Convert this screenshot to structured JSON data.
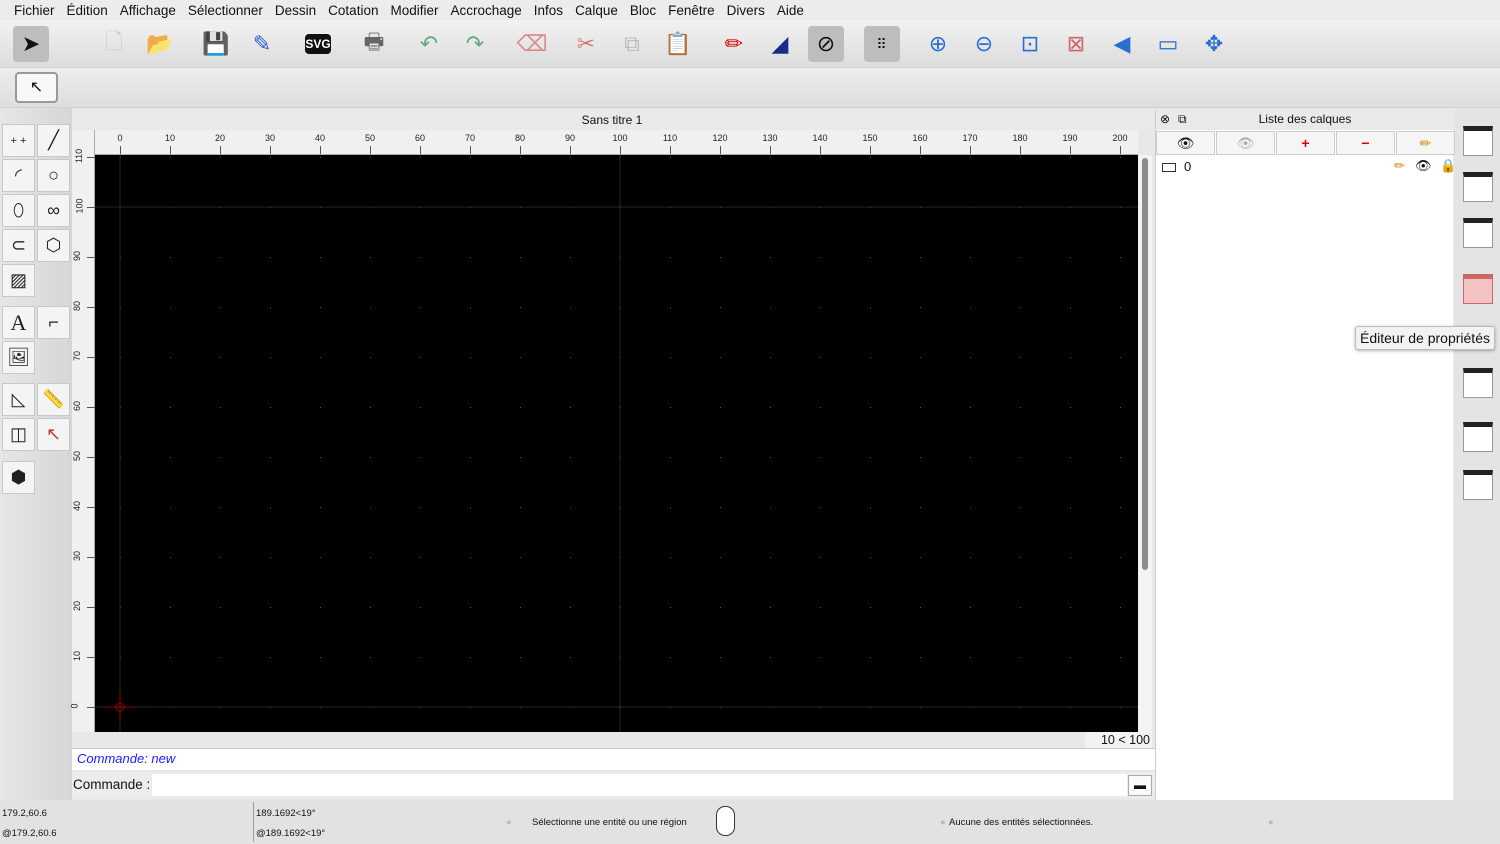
{
  "menu": [
    "Fichier",
    "Édition",
    "Affichage",
    "Sélectionner",
    "Dessin",
    "Cotation",
    "Modifier",
    "Accrochage",
    "Infos",
    "Calque",
    "Bloc",
    "Fenêtre",
    "Divers",
    "Aide"
  ],
  "document": {
    "title": "Sans titre 1",
    "zoom_label": "10 < 100"
  },
  "ruler": {
    "x_labels": [
      "0",
      "10",
      "20",
      "30",
      "40",
      "50",
      "60",
      "70",
      "80",
      "90",
      "100",
      "110",
      "120",
      "130",
      "140",
      "150",
      "160",
      "170",
      "180",
      "190",
      "200"
    ],
    "y_labels": [
      "0",
      "10",
      "20",
      "30",
      "40",
      "50",
      "60",
      "70",
      "80",
      "90",
      "100",
      "110"
    ]
  },
  "command": {
    "history": "Commande: new",
    "label": "Commande :",
    "value": ""
  },
  "layers": {
    "title": "Liste des calques",
    "items": [
      {
        "name": "0"
      }
    ]
  },
  "tooltip": "Éditeur de propriétés",
  "status": {
    "abs_coord": "179.2,60.6",
    "rel_coord": "@179.2,60.6",
    "polar": "189.1692<19°",
    "rel_polar": "@189.1692<19°",
    "hint": "Sélectionne une entité ou une région",
    "selection": "Aucune des entités sélectionnées."
  },
  "colors": {
    "canvas": "#000000",
    "command_history": "#1a1aff",
    "grid": "#3a3a3a"
  }
}
